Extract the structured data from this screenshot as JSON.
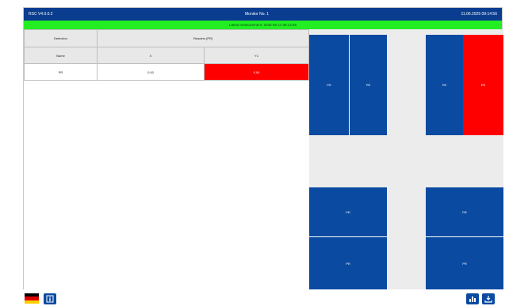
{
  "header": {
    "left": "RSC V4.0.0.2",
    "center": "Monitor No. 1",
    "right": "11.06.2025 09:14:56"
  },
  "status_bar": {
    "text": "Latest measurement: 2025-06-11 09:14:56"
  },
  "table": {
    "col1_header": "Detection",
    "group_header": "Readers [PR]",
    "row2_col1": "Name",
    "subcols": [
      "X",
      "Y1"
    ],
    "rows": [
      {
        "name": "PR",
        "x": "0.00",
        "y1": "0.00"
      }
    ]
  },
  "tiles": {
    "t1": "PR",
    "t2": "PR",
    "t3": "PR",
    "t4": "PR",
    "t5": "PR",
    "t6": "PR",
    "t7": "PR",
    "t8": "PR"
  },
  "colors": {
    "header_blue": "#0a3d8f",
    "status_green": "#22ee22",
    "tile_blue": "#0a4aa1",
    "alarm_red": "#ff0000"
  },
  "icons": {
    "language": "german-flag-icon",
    "info": "info-icon",
    "chart": "chart-icon",
    "export": "export-icon"
  }
}
